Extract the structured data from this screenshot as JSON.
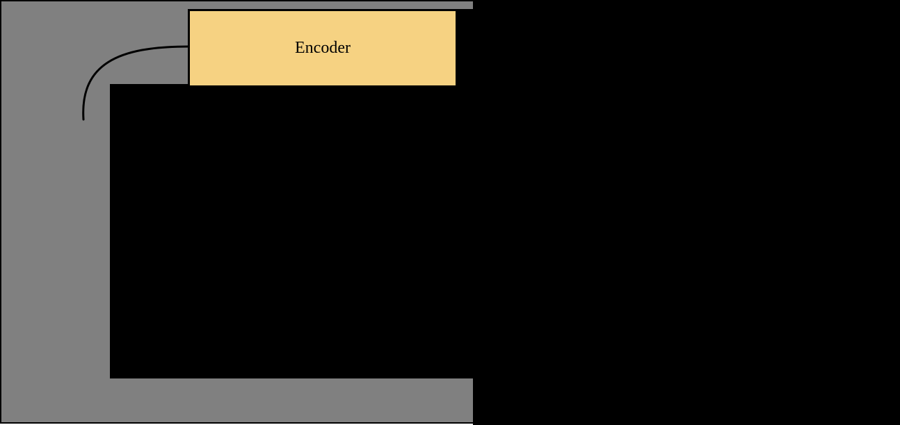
{
  "diagram": {
    "encoder_label": "Encoder"
  }
}
